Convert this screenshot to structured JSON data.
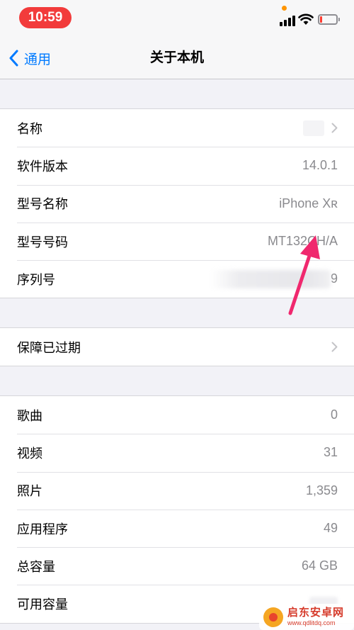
{
  "status_bar": {
    "time": "10:59",
    "battery_level": 0.15,
    "colors": {
      "time_pill": "#f23b3b",
      "privacy_dot": "#ff9500",
      "battery_low": "#ff3b30"
    }
  },
  "nav": {
    "back_label": "通用",
    "title": "关于本机",
    "accent": "#007aff"
  },
  "groups": [
    {
      "rows": [
        {
          "label": "名称",
          "value": "",
          "chevron": true
        },
        {
          "label": "软件版本",
          "value": "14.0.1"
        },
        {
          "label": "型号名称",
          "value": "iPhone Xʀ"
        },
        {
          "label": "型号号码",
          "value": "MT132CH/A"
        },
        {
          "label": "序列号",
          "value": "9"
        }
      ]
    },
    {
      "rows": [
        {
          "label": "保障已过期",
          "value": "",
          "chevron": true
        }
      ]
    },
    {
      "rows": [
        {
          "label": "歌曲",
          "value": "0"
        },
        {
          "label": "视频",
          "value": "31"
        },
        {
          "label": "照片",
          "value": "1,359"
        },
        {
          "label": "应用程序",
          "value": "49"
        },
        {
          "label": "总容量",
          "value": "64 GB"
        },
        {
          "label": "可用容量",
          "value": ""
        }
      ]
    }
  ],
  "watermark": {
    "name": "启东安卓网",
    "url": "www.qdlitdq.com"
  },
  "annotation": {
    "color": "#f0286e"
  }
}
